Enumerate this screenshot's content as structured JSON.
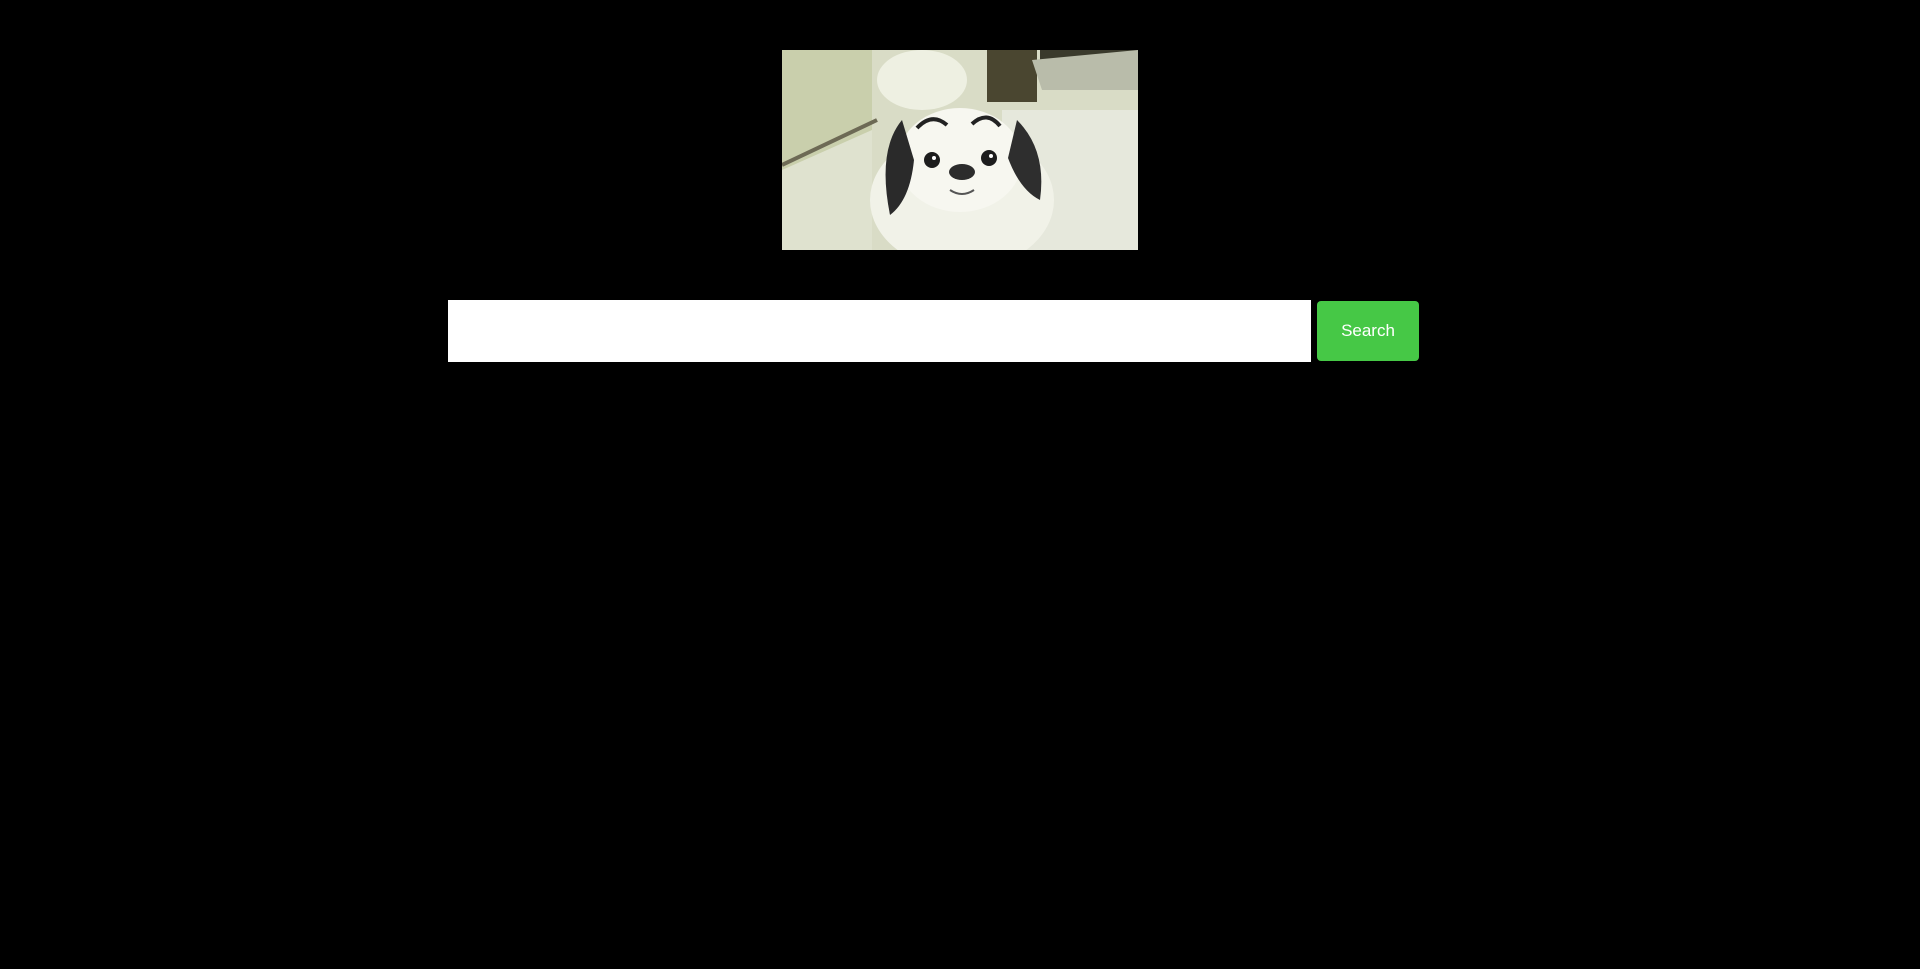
{
  "hero": {
    "icon": "dog-photo",
    "alt": ""
  },
  "search": {
    "value": "",
    "placeholder": "",
    "button_label": "Search"
  },
  "colors": {
    "background": "#000000",
    "button": "#46c846",
    "button_text": "#ffffff",
    "input_background": "#ffffff"
  }
}
